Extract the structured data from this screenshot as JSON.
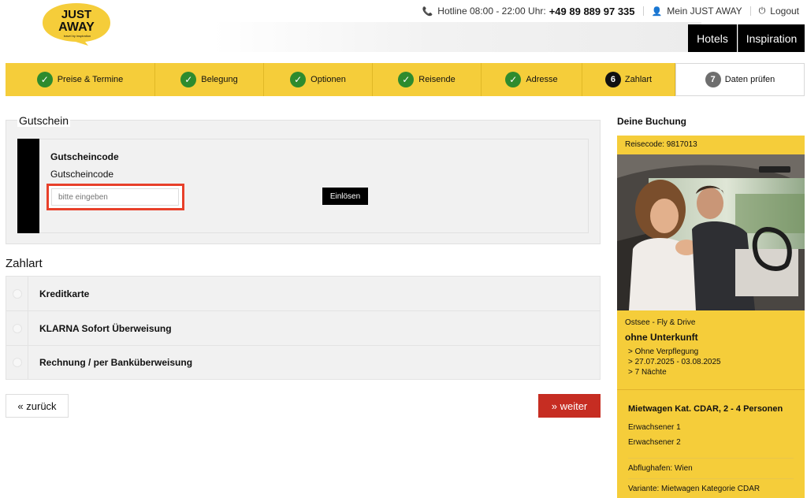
{
  "header": {
    "logo": {
      "line1": "JUST",
      "line2": "AWAY",
      "tagline": "travel by inspiration"
    },
    "hotline_label": "Hotline 08:00 - 22:00 Uhr:",
    "hotline_number": "+49 89 889 97 335",
    "account_label": "Mein JUST AWAY",
    "logout_label": "Logout",
    "nav": [
      {
        "label": "Hotels"
      },
      {
        "label": "Inspiration"
      }
    ]
  },
  "steps": [
    {
      "label": "Preise & Termine",
      "state": "done"
    },
    {
      "label": "Belegung",
      "state": "done"
    },
    {
      "label": "Optionen",
      "state": "done"
    },
    {
      "label": "Reisende",
      "state": "done"
    },
    {
      "label": "Adresse",
      "state": "done"
    },
    {
      "label": "Zahlart",
      "number": "6",
      "state": "current"
    },
    {
      "label": "Daten prüfen",
      "number": "7",
      "state": "upcoming"
    }
  ],
  "voucher": {
    "section_title": "Gutschein",
    "title": "Gutscheincode",
    "field_label": "Gutscheincode",
    "placeholder": "bitte eingeben",
    "value": "",
    "button_label": "Einlösen"
  },
  "payment": {
    "title": "Zahlart",
    "options": [
      {
        "label": "Kreditkarte"
      },
      {
        "label": "KLARNA Sofort Überweisung"
      },
      {
        "label": "Rechnung / per Banküberweisung"
      }
    ]
  },
  "actions": {
    "back_label": "«  zurück",
    "next_label": "»  weiter"
  },
  "booking": {
    "title": "Deine Buchung",
    "reisecode": "Reisecode: 9817013",
    "region": "Ostsee - Fly & Drive",
    "accommodation": "ohne Unterkunft",
    "details": [
      "> Ohne Verpflegung",
      "> 27.07.2025 - 03.08.2025",
      "> 7 Nächte"
    ],
    "car": "Mietwagen Kat. CDAR, 2 - 4 Personen",
    "travellers": [
      "Erwachsener 1",
      "Erwachsener 2"
    ],
    "airport": "Abflughafen: Wien",
    "variant": "Variante: Mietwagen Kategorie CDAR"
  },
  "colors": {
    "brand_yellow": "#f5cd3a",
    "check_green": "#2e8b2e",
    "next_red": "#c62d22",
    "highlight_red": "#e8402a"
  }
}
